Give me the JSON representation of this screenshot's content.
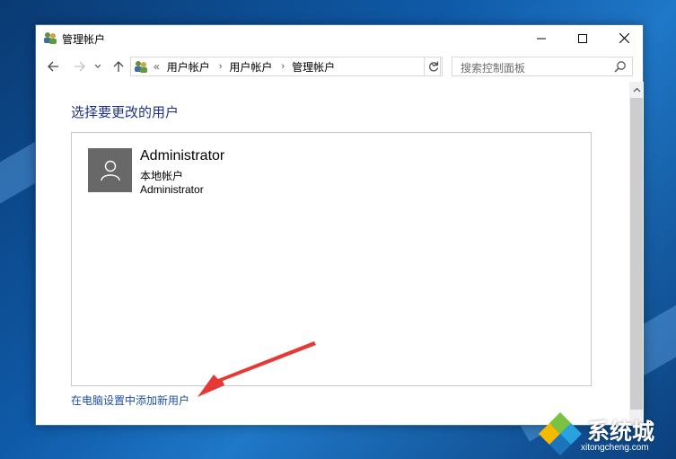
{
  "window": {
    "title": "管理帐户",
    "controls": {
      "minimize": "minimize-icon",
      "maximize": "maximize-icon",
      "close": "close-icon"
    }
  },
  "address_bar": {
    "overflow": "«",
    "breadcrumbs": [
      "用户帐户",
      "用户帐户",
      "管理帐户"
    ],
    "separator": "›",
    "search_placeholder": "搜索控制面板"
  },
  "main": {
    "heading": "选择要更改的用户",
    "accounts": [
      {
        "name": "Administrator",
        "type": "本地帐户",
        "detail": "Administrator"
      }
    ],
    "add_user_link": "在电脑设置中添加新用户"
  },
  "watermark": {
    "brand": "系统城",
    "url": "xitongcheng.com"
  },
  "colors": {
    "heading": "#1e3287",
    "link": "#1e4ea1",
    "avatar": "#686868",
    "annotation_arrow": "#e53935"
  }
}
